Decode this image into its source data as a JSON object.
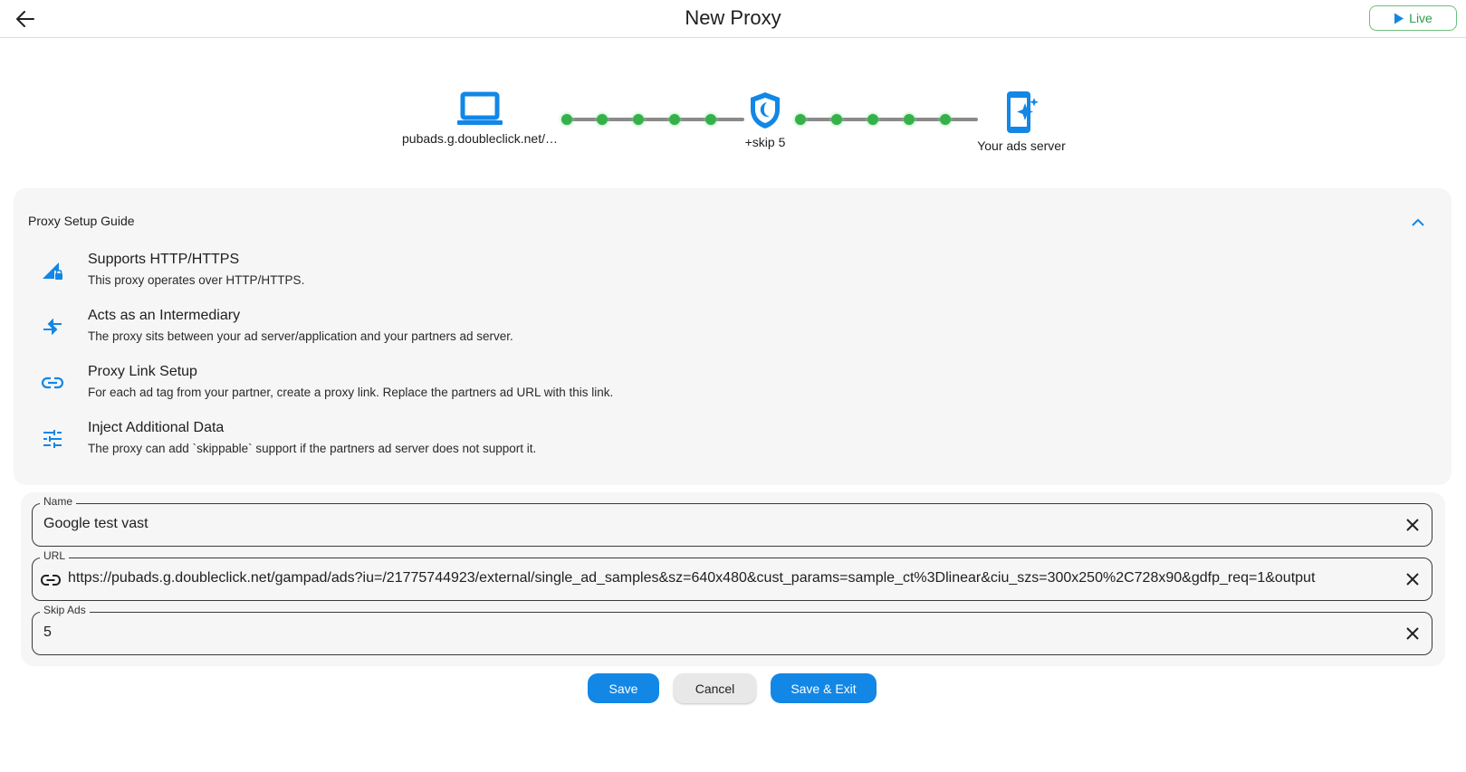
{
  "header": {
    "title": "New Proxy",
    "live_label": "Live"
  },
  "flow": {
    "source_label": "pubads.g.doubleclick.net/…",
    "middle_label": "+skip 5",
    "target_label": "Your ads server"
  },
  "guide": {
    "title": "Proxy Setup Guide",
    "items": [
      {
        "icon": "signal-lock-icon",
        "title": "Supports HTTP/HTTPS",
        "description": "This proxy operates over HTTP/HTTPS."
      },
      {
        "icon": "compare-arrows-icon",
        "title": "Acts as an Intermediary",
        "description": "The proxy sits between your ad server/application and your partners ad server."
      },
      {
        "icon": "link-icon",
        "title": "Proxy Link Setup",
        "description": "For each ad tag from your partner, create a proxy link. Replace the partners ad URL with this link."
      },
      {
        "icon": "tune-icon",
        "title": "Inject Additional Data",
        "description": "The proxy can add `skippable` support if the partners ad server does not support it."
      }
    ]
  },
  "form": {
    "name_label": "Name",
    "name_value": "Google test vast",
    "url_label": "URL",
    "url_value": "https://pubads.g.doubleclick.net/gampad/ads?iu=/21775744923/external/single_ad_samples&sz=640x480&cust_params=sample_ct%3Dlinear&ciu_szs=300x250%2C728x90&gdfp_req=1&output",
    "skip_label": "Skip Ads",
    "skip_value": "5"
  },
  "actions": {
    "save_label": "Save",
    "cancel_label": "Cancel",
    "save_exit_label": "Save & Exit"
  },
  "colors": {
    "accent": "#1287e6",
    "live_green": "#2e9c4a",
    "dot_green": "#36b04a"
  }
}
